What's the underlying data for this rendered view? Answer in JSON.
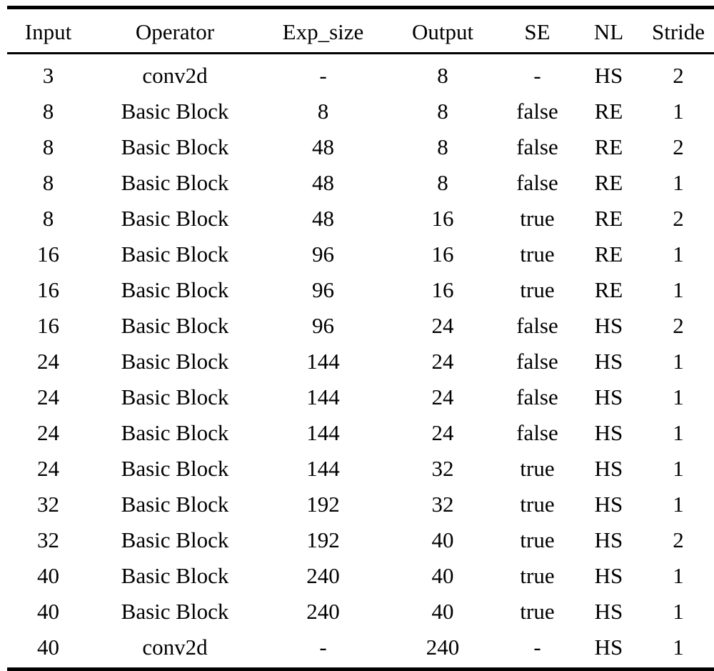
{
  "table": {
    "caption": "",
    "columns": [
      {
        "key": "input",
        "label": "Input"
      },
      {
        "key": "operator",
        "label": "Operator"
      },
      {
        "key": "exp_size",
        "label": "Exp_size"
      },
      {
        "key": "output",
        "label": "Output"
      },
      {
        "key": "se",
        "label": "SE"
      },
      {
        "key": "nl",
        "label": "NL"
      },
      {
        "key": "stride",
        "label": "Stride"
      }
    ],
    "rows": [
      {
        "input": "3",
        "operator": "conv2d",
        "exp_size": "-",
        "output": "8",
        "se": "-",
        "nl": "HS",
        "stride": "2"
      },
      {
        "input": "8",
        "operator": "Basic Block",
        "exp_size": "8",
        "output": "8",
        "se": "false",
        "nl": "RE",
        "stride": "1"
      },
      {
        "input": "8",
        "operator": "Basic Block",
        "exp_size": "48",
        "output": "8",
        "se": "false",
        "nl": "RE",
        "stride": "2"
      },
      {
        "input": "8",
        "operator": "Basic Block",
        "exp_size": "48",
        "output": "8",
        "se": "false",
        "nl": "RE",
        "stride": "1"
      },
      {
        "input": "8",
        "operator": "Basic Block",
        "exp_size": "48",
        "output": "16",
        "se": "true",
        "nl": "RE",
        "stride": "2"
      },
      {
        "input": "16",
        "operator": "Basic Block",
        "exp_size": "96",
        "output": "16",
        "se": "true",
        "nl": "RE",
        "stride": "1"
      },
      {
        "input": "16",
        "operator": "Basic Block",
        "exp_size": "96",
        "output": "16",
        "se": "true",
        "nl": "RE",
        "stride": "1"
      },
      {
        "input": "16",
        "operator": "Basic Block",
        "exp_size": "96",
        "output": "24",
        "se": "false",
        "nl": "HS",
        "stride": "2"
      },
      {
        "input": "24",
        "operator": "Basic Block",
        "exp_size": "144",
        "output": "24",
        "se": "false",
        "nl": "HS",
        "stride": "1"
      },
      {
        "input": "24",
        "operator": "Basic Block",
        "exp_size": "144",
        "output": "24",
        "se": "false",
        "nl": "HS",
        "stride": "1"
      },
      {
        "input": "24",
        "operator": "Basic Block",
        "exp_size": "144",
        "output": "24",
        "se": "false",
        "nl": "HS",
        "stride": "1"
      },
      {
        "input": "24",
        "operator": "Basic Block",
        "exp_size": "144",
        "output": "32",
        "se": "true",
        "nl": "HS",
        "stride": "1"
      },
      {
        "input": "32",
        "operator": "Basic Block",
        "exp_size": "192",
        "output": "32",
        "se": "true",
        "nl": "HS",
        "stride": "1"
      },
      {
        "input": "32",
        "operator": "Basic Block",
        "exp_size": "192",
        "output": "40",
        "se": "true",
        "nl": "HS",
        "stride": "2"
      },
      {
        "input": "40",
        "operator": "Basic Block",
        "exp_size": "240",
        "output": "40",
        "se": "true",
        "nl": "HS",
        "stride": "1"
      },
      {
        "input": "40",
        "operator": "Basic Block",
        "exp_size": "240",
        "output": "40",
        "se": "true",
        "nl": "HS",
        "stride": "1"
      },
      {
        "input": "40",
        "operator": "conv2d",
        "exp_size": "-",
        "output": "240",
        "se": "-",
        "nl": "HS",
        "stride": "1"
      }
    ]
  },
  "style": {
    "text_color": "#000000",
    "background_color": "#ffffff",
    "rule_color": "#000000"
  }
}
